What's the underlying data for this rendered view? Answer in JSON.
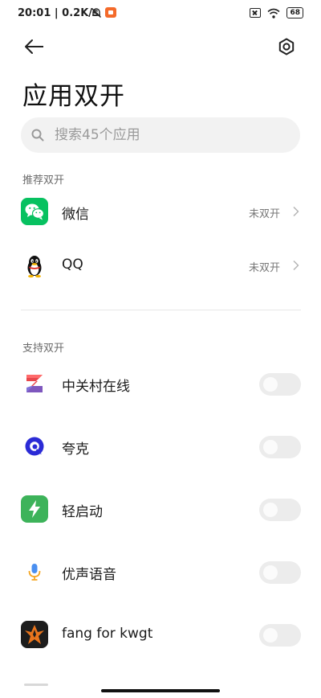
{
  "status_bar": {
    "time_speed": "20:01 | 0.2K/s",
    "battery": "68"
  },
  "header": {
    "title": "应用双开"
  },
  "search": {
    "placeholder": "搜索45个应用"
  },
  "recommended": {
    "label": "推荐双开",
    "items": [
      {
        "name": "微信",
        "status": "未双开",
        "icon": "wechat-icon",
        "color": "#07c160"
      },
      {
        "name": "QQ",
        "status": "未双开",
        "icon": "qq-penguin-icon",
        "color": "#111111"
      }
    ]
  },
  "supported": {
    "label": "支持双开",
    "items": [
      {
        "name": "中关村在线",
        "icon": "zol-icon",
        "enabled": false
      },
      {
        "name": "夸克",
        "icon": "quark-icon",
        "enabled": false
      },
      {
        "name": "轻启动",
        "icon": "lightning-icon",
        "enabled": false
      },
      {
        "name": "优声语音",
        "icon": "microphone-icon",
        "enabled": false
      },
      {
        "name": "fang for kwgt",
        "icon": "fang-icon",
        "enabled": false
      }
    ]
  },
  "colors": {
    "toggle_off": "#ececec",
    "accent_wechat": "#07c160",
    "accent_light_launch": "#3db35a",
    "accent_quark": "#2b2bd6"
  }
}
